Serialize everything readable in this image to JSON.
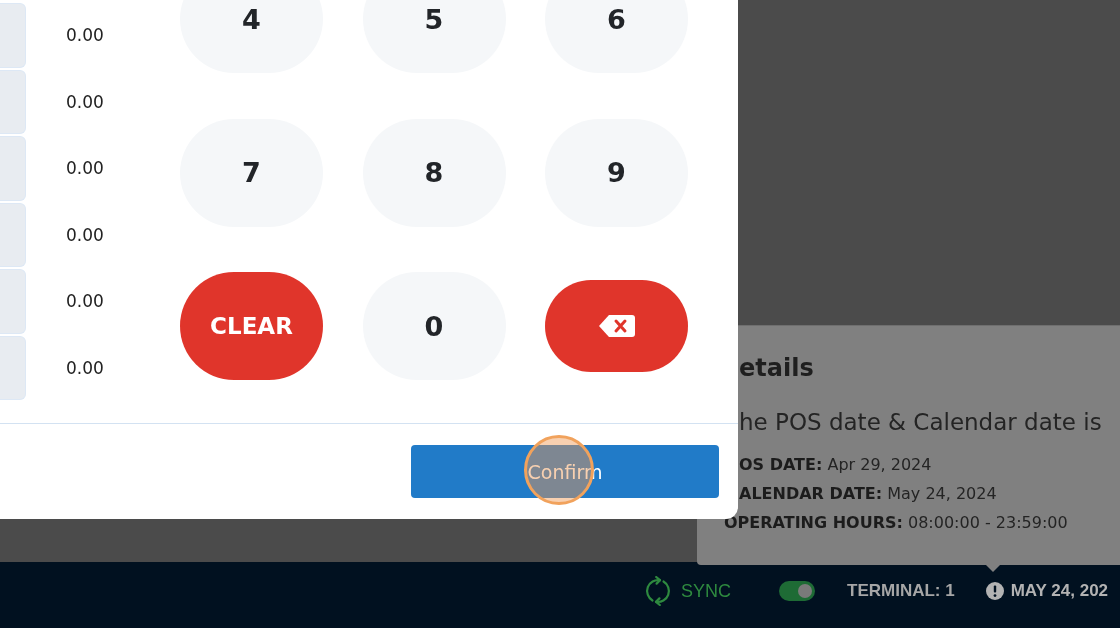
{
  "rows": [
    {
      "value": "0.00"
    },
    {
      "value": "0.00"
    },
    {
      "value": "0.00"
    },
    {
      "value": "0.00"
    },
    {
      "value": "0.00"
    },
    {
      "value": "0.00"
    }
  ],
  "keypad": [
    {
      "kind": "digit",
      "label": "4"
    },
    {
      "kind": "digit",
      "label": "5"
    },
    {
      "kind": "digit",
      "label": "6"
    },
    {
      "kind": "digit",
      "label": "7"
    },
    {
      "kind": "digit",
      "label": "8"
    },
    {
      "kind": "digit",
      "label": "9"
    },
    {
      "kind": "clear",
      "label": "CLEAR"
    },
    {
      "kind": "digit",
      "label": "0"
    },
    {
      "kind": "backspace"
    }
  ],
  "confirm_button": {
    "label": "Confirm",
    "highlighted": true
  },
  "details": {
    "title": "etails",
    "message": "he POS date & Calendar date is",
    "facts": [
      {
        "label": "OS DATE:",
        "value": "Apr 29, 2024"
      },
      {
        "label": "ALENDAR DATE:",
        "value": "May 24, 2024"
      },
      {
        "label": "OPERATING HOURS:",
        "value": "08:00:00 - 23:59:00"
      }
    ]
  },
  "status_bar": {
    "sync": "SYNC",
    "toggle": {
      "on": true
    },
    "terminal": "TERMINAL: 1",
    "date": "MAY 24, 202"
  }
}
